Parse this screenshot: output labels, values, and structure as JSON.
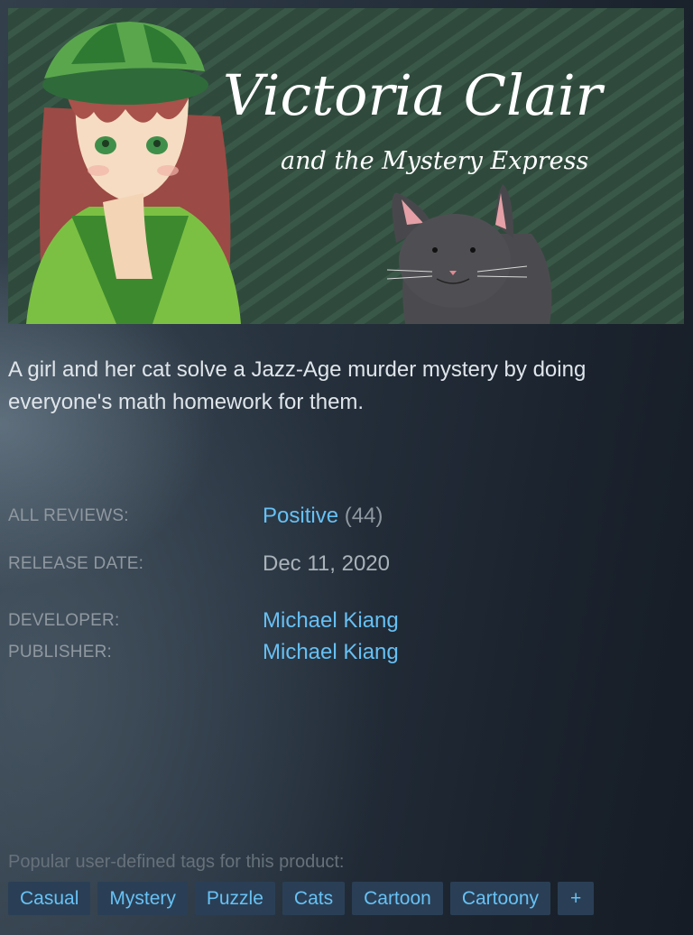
{
  "capsule": {
    "title": "Victoria Clair",
    "subtitle": "and the Mystery Express",
    "bg_color": "#2f4a3c"
  },
  "description": "A girl and her cat solve a Jazz-Age murder mystery by doing everyone's math homework for them.",
  "reviews": {
    "label": "ALL REVIEWS:",
    "summary": "Positive",
    "count": "(44)"
  },
  "release": {
    "label": "RELEASE DATE:",
    "date": "Dec 11, 2020"
  },
  "developer": {
    "label": "DEVELOPER:",
    "name": "Michael Kiang"
  },
  "publisher": {
    "label": "PUBLISHER:",
    "name": "Michael Kiang"
  },
  "tags": {
    "title": "Popular user-defined tags for this product:",
    "items": [
      "Casual",
      "Mystery",
      "Puzzle",
      "Cats",
      "Cartoon",
      "Cartoony"
    ],
    "more": "+"
  },
  "colors": {
    "link": "#66c0f4",
    "tag_bg": "#2a3f55",
    "tag_text": "#67c1f5"
  }
}
